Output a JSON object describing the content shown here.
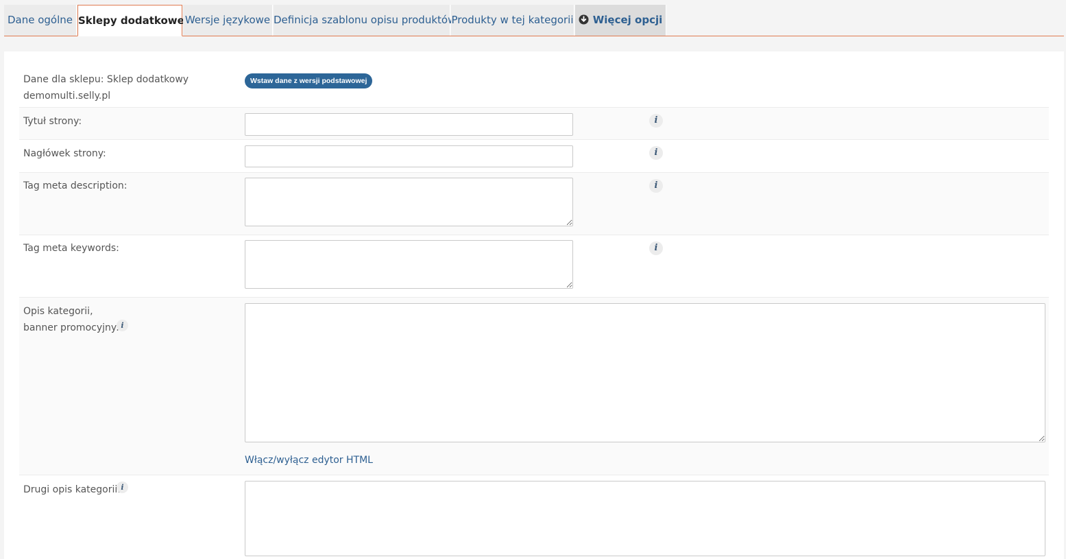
{
  "tabs": [
    {
      "label": "Dane ogólne"
    },
    {
      "label": "Sklepy dodatkowe"
    },
    {
      "label": "Wersje językowe"
    },
    {
      "label": "Definicja szablonu opisu produktów"
    },
    {
      "label": "Produkty w tej kategorii"
    },
    {
      "label": "Więcej opcji"
    }
  ],
  "shop": {
    "label_line1": "Dane dla sklepu: Sklep dodatkowy",
    "label_line2": "demomulti.selly.pl",
    "insert_button": "Wstaw dane z wersji podstawowej"
  },
  "fields": {
    "page_title": {
      "label": "Tytuł strony:",
      "value": ""
    },
    "page_header": {
      "label": "Nagłówek strony:",
      "value": ""
    },
    "meta_description": {
      "label": "Tag meta description:",
      "value": ""
    },
    "meta_keywords": {
      "label": "Tag meta keywords:",
      "value": ""
    },
    "category_description": {
      "label_line1": "Opis kategorii,",
      "label_line2": "banner promocyjny:",
      "value": ""
    },
    "second_description": {
      "label": "Drugi opis kategorii:",
      "value": ""
    }
  },
  "html_editor_toggle": "Włącz/wyłącz edytor HTML",
  "info_glyph": "i",
  "colors": {
    "accent": "#e07a4f",
    "link": "#2d5f91",
    "button": "#2d6698"
  }
}
